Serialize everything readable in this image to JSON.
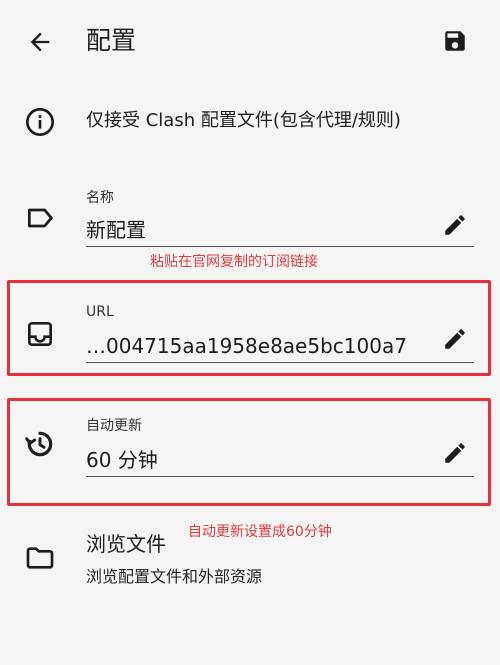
{
  "appbar": {
    "title": "配置",
    "back_icon": "arrow-back-icon",
    "save_icon": "save-icon"
  },
  "info": {
    "text": "仅接受 Clash 配置文件(包含代理/规则)",
    "icon": "info-icon"
  },
  "fields": {
    "name": {
      "label": "名称",
      "value": "新配置",
      "icon": "label-tag-icon"
    },
    "url": {
      "label": "URL",
      "value": "…004715aa1958e8ae5bc100a7",
      "icon": "inbox-icon"
    },
    "auto_update": {
      "label": "自动更新",
      "value": "60 分钟",
      "icon": "history-clock-icon"
    }
  },
  "browse": {
    "title": "浏览文件",
    "subtitle": "浏览配置文件和外部资源",
    "icon": "folder-icon"
  },
  "annotations": {
    "url_hint": "粘贴在官网复制的订阅链接",
    "update_hint": "自动更新设置成60分钟"
  },
  "colors": {
    "annotation": "#e03b3b",
    "background": "#f5f5f5"
  }
}
